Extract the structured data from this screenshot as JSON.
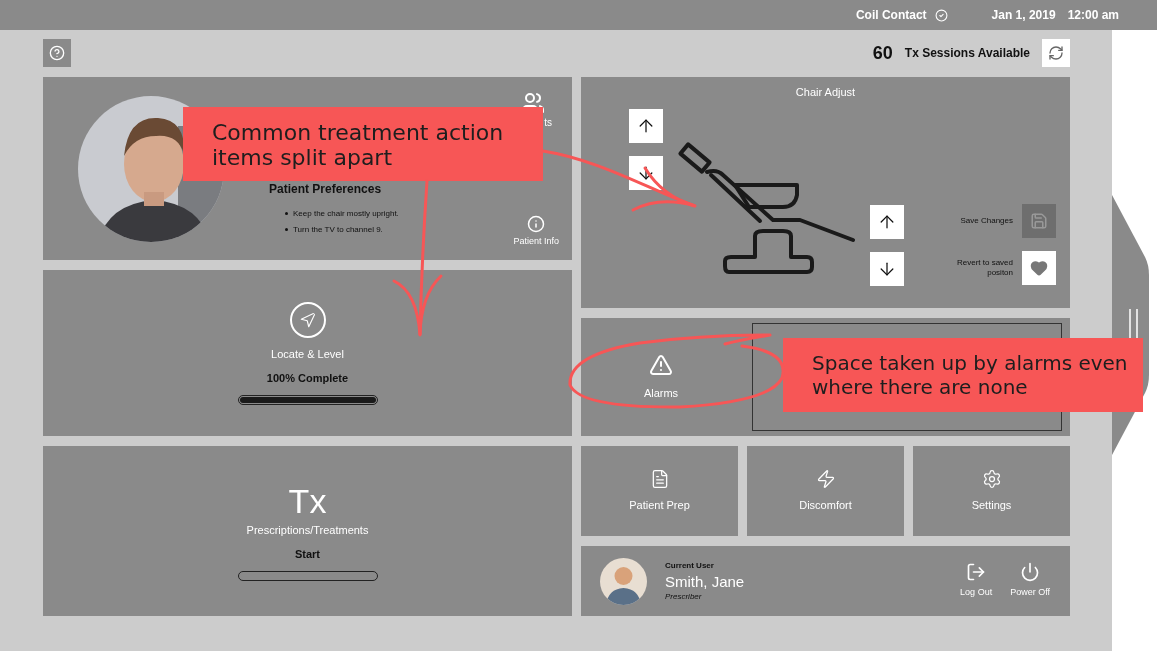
{
  "status_bar": {
    "connection": "Coil Contact",
    "date": "Jan 1, 2019",
    "time": "12:00 am"
  },
  "header": {
    "sessions_count": "60",
    "sessions_label": "Tx Sessions Available"
  },
  "patient_card": {
    "contacts_label": "ts",
    "preferences_title": "Patient Preferences",
    "preferences": [
      "Keep the chair mostly upright.",
      "Turn the TV to channel 9."
    ],
    "info_label": "Patient Info"
  },
  "locate_card": {
    "title": "Locate & Level",
    "status": "100% Complete",
    "level": 1
  },
  "tx_card": {
    "symbol": "Tx",
    "title": "Prescriptions/Treatments",
    "status": "Start"
  },
  "chair_card": {
    "title": "Chair Adjust",
    "actions": [
      {
        "label": "Save Changes",
        "kind": "save",
        "disabled": true
      },
      {
        "label": "Revert to saved positon",
        "kind": "revert",
        "disabled": false
      }
    ]
  },
  "alarms_card": {
    "label": "Alarms"
  },
  "tiles": [
    {
      "label": "Patient Prep",
      "kind": "document"
    },
    {
      "label": "Discomfort",
      "kind": "bolt"
    },
    {
      "label": "Settings",
      "kind": "settings"
    }
  ],
  "user": {
    "caption": "Current User",
    "name": "Smith, Jane",
    "role": "Prescriber"
  },
  "user_actions": [
    {
      "label": "Log Out",
      "kind": "logout"
    },
    {
      "label": "Power Off",
      "kind": "power"
    }
  ],
  "annotations": [
    {
      "text": "Common treatment action items split apart"
    },
    {
      "text": "Space taken up by alarms even where there are none"
    }
  ]
}
